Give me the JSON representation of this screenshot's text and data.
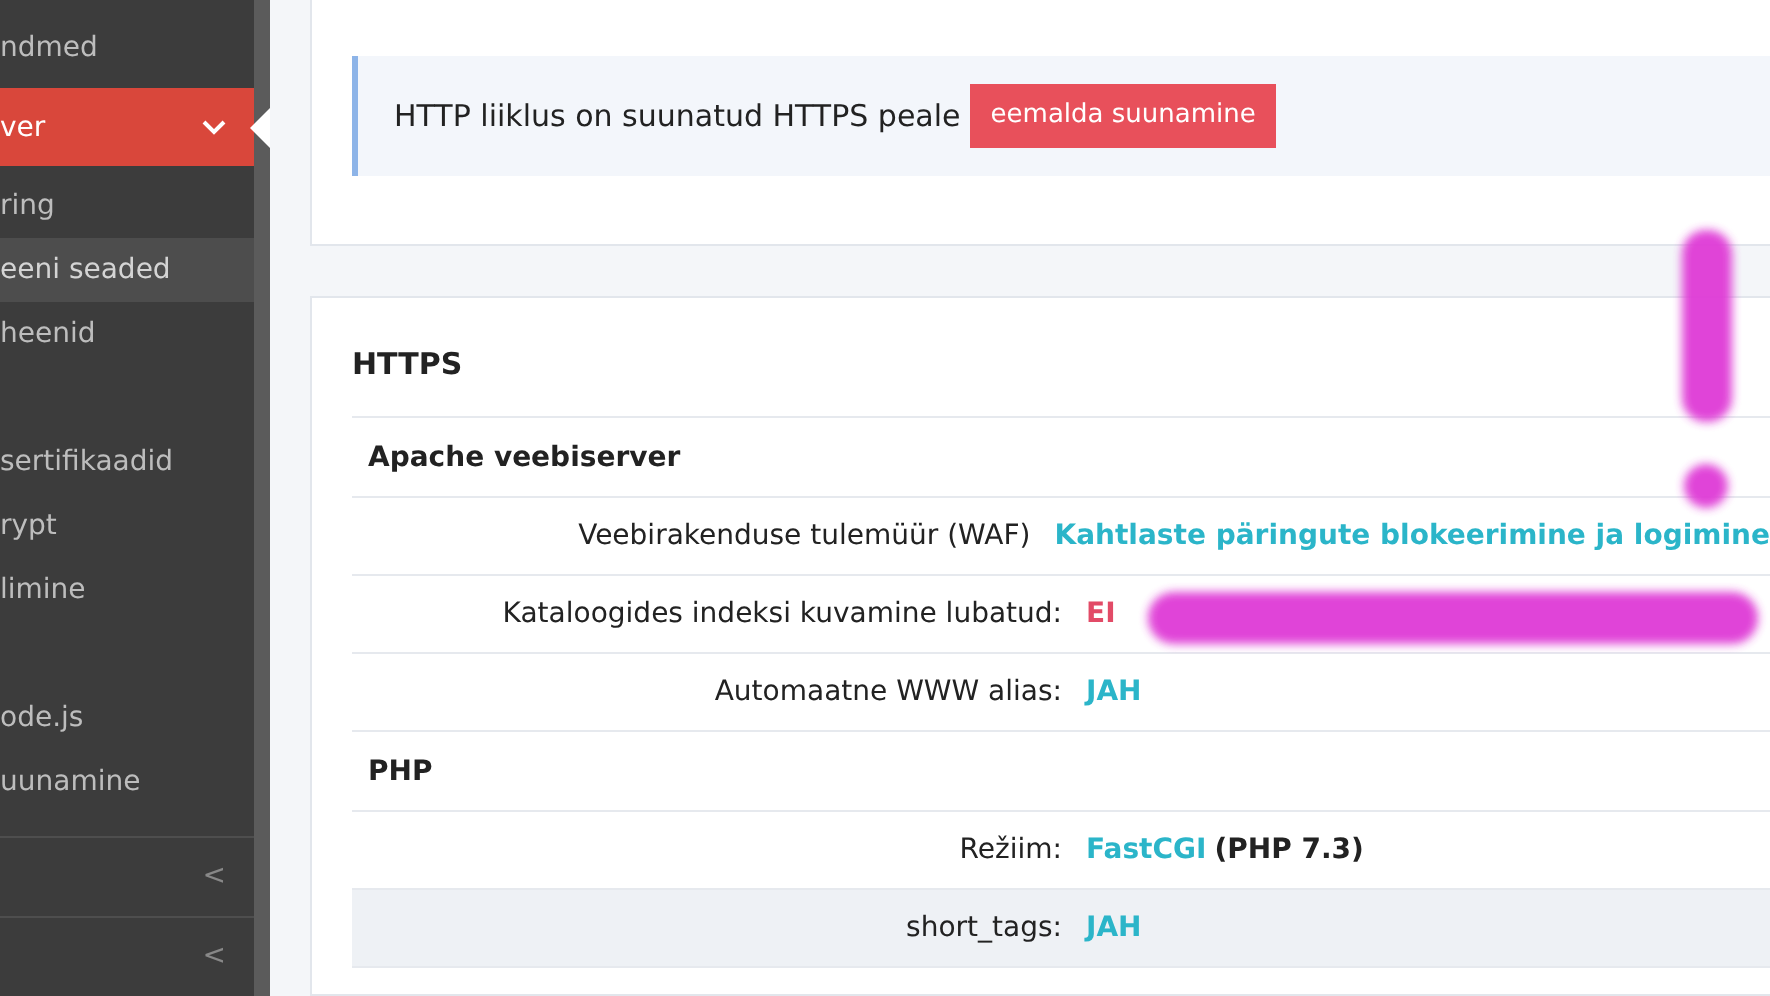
{
  "sidebar": {
    "items": [
      {
        "label": "ndmed",
        "expanded": false,
        "highlighted": false
      },
      {
        "label": "ver",
        "expanded": true,
        "highlighted": false
      },
      {
        "label": "ring",
        "expanded": false,
        "highlighted": false
      },
      {
        "label": "eeni seaded",
        "expanded": false,
        "highlighted": true
      },
      {
        "label": "heenid",
        "expanded": false,
        "highlighted": false
      },
      {
        "label": "sertifikaadid",
        "expanded": false,
        "highlighted": false,
        "space_before": true
      },
      {
        "label": "rypt",
        "expanded": false,
        "highlighted": false
      },
      {
        "label": "limine",
        "expanded": false,
        "highlighted": false
      },
      {
        "label": "ode.js",
        "expanded": false,
        "highlighted": false,
        "space_before": true
      },
      {
        "label": "uunamine",
        "expanded": false,
        "highlighted": false
      }
    ],
    "collapsed_groups": [
      {
        "icon": "<"
      },
      {
        "icon": "<"
      }
    ]
  },
  "redirect_notice": {
    "text": "HTTP liiklus on suunatud HTTPS peale",
    "button": "eemalda suunamine"
  },
  "https_card": {
    "title": "HTTPS",
    "sections": [
      {
        "title": "Apache veebiserver",
        "rows": [
          {
            "label": "Veebirakenduse tulemüür (WAF)",
            "value": "Kahtlaste päringute blokeerimine ja logimine",
            "color": "#2bb5c9",
            "selected": false
          },
          {
            "label": "Kataloogides indeksi kuvamine lubatud:",
            "value": "EI",
            "color": "#e24b67",
            "selected": false
          },
          {
            "label": "Automaatne WWW alias:",
            "value": "JAH",
            "color": "#2bb5c9",
            "selected": false
          }
        ]
      },
      {
        "title": "PHP",
        "rows": [
          {
            "label": "Režiim:",
            "value": "FastCGI",
            "note": "(PHP 7.3)",
            "color": "#2bb5c9",
            "selected": false
          },
          {
            "label": "short_tags:",
            "value": "JAH",
            "color": "#2bb5c9",
            "selected": true
          }
        ]
      }
    ]
  },
  "annotation": {
    "kind": "marker"
  }
}
